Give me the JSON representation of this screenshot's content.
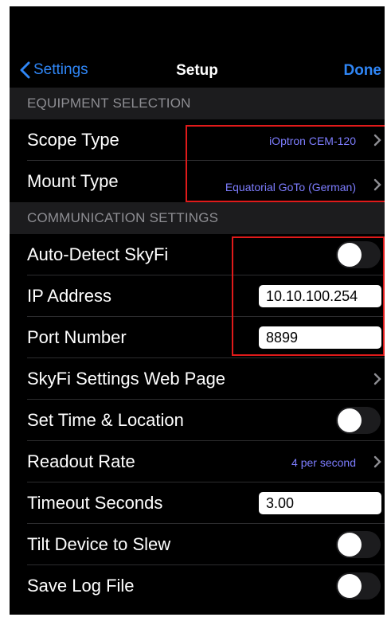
{
  "nav": {
    "back_label": "Settings",
    "title": "Setup",
    "done_label": "Done"
  },
  "sections": {
    "equipment": "EQUIPMENT SELECTION",
    "communication": "COMMUNICATION SETTINGS"
  },
  "rows": {
    "scope_type": {
      "label": "Scope Type",
      "value": "iOptron CEM-120"
    },
    "mount_type": {
      "label": "Mount Type",
      "value": "Equatorial GoTo (German)"
    },
    "auto_detect": {
      "label": "Auto-Detect SkyFi",
      "on": false
    },
    "ip_address": {
      "label": "IP Address",
      "value": "10.10.100.254"
    },
    "port_number": {
      "label": "Port Number",
      "value": "8899"
    },
    "skyfi_web": {
      "label": "SkyFi Settings Web Page"
    },
    "set_time": {
      "label": "Set Time & Location",
      "on": false
    },
    "readout_rate": {
      "label": "Readout Rate",
      "value": "4 per second"
    },
    "timeout": {
      "label": "Timeout Seconds",
      "value": "3.00"
    },
    "tilt": {
      "label": "Tilt Device to Slew",
      "on": false
    },
    "save_log": {
      "label": "Save Log File",
      "on": false
    }
  },
  "colors": {
    "accent": "#2f86f6",
    "value_text": "#7d7dff",
    "highlight": "#e01a1a"
  }
}
